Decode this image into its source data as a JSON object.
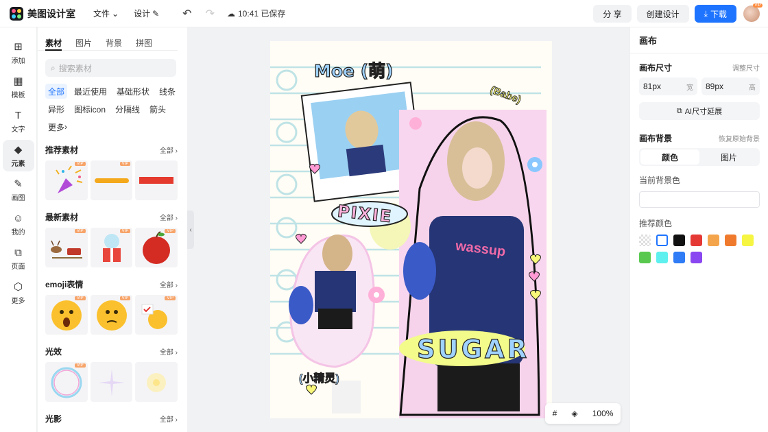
{
  "app": {
    "title": "美图设计室"
  },
  "menu": {
    "file": "文件",
    "design": "设计",
    "saved": "10:41 已保存"
  },
  "actions": {
    "share": "分 享",
    "create": "创建设计",
    "download": "下载",
    "vip": "VIP"
  },
  "rail": [
    {
      "label": "添加",
      "icon": "plus-icon"
    },
    {
      "label": "模板",
      "icon": "template-icon"
    },
    {
      "label": "文字",
      "icon": "text-icon"
    },
    {
      "label": "元素",
      "icon": "elements-icon"
    },
    {
      "label": "画图",
      "icon": "draw-icon"
    },
    {
      "label": "我的",
      "icon": "user-icon"
    },
    {
      "label": "页面",
      "icon": "page-icon"
    },
    {
      "label": "更多",
      "icon": "more-icon"
    }
  ],
  "panel": {
    "tabs": [
      "素材",
      "图片",
      "背景",
      "拼图"
    ],
    "search_placeholder": "搜索素材",
    "chips": [
      "全部",
      "最近使用",
      "基础形状",
      "线条",
      "异形",
      "图标icon",
      "分隔线",
      "箭头",
      "更多"
    ],
    "sections": [
      {
        "title": "推荐素材",
        "all": "全部"
      },
      {
        "title": "最新素材",
        "all": "全部"
      },
      {
        "title": "emoji表情",
        "all": "全部"
      },
      {
        "title": "光效",
        "all": "全部"
      },
      {
        "title": "光影",
        "all": "全部"
      }
    ],
    "vip": "VIP"
  },
  "canvas": {
    "texts": {
      "moe": "Moe (萌)",
      "babe": "(Babe)",
      "pixie": "PIXIE",
      "sugar": "SUGAR",
      "elf": "(小精灵)",
      "wassup": "wassup"
    }
  },
  "zoom": "100%",
  "inspector": {
    "title": "画布",
    "size_label": "画布尺寸",
    "adjust": "调整尺寸",
    "width": "81px",
    "width_unit": "宽",
    "height": "89px",
    "height_unit": "高",
    "ai_button": "AI尺寸延展",
    "bg_label": "画布背景",
    "restore": "恢复原始背景",
    "seg": [
      "颜色",
      "图片"
    ],
    "current_bg": "当前背景色",
    "recommend": "推荐颜色",
    "colors": [
      "#ffffff",
      "#111111",
      "#e53935",
      "#f4a54c",
      "#ef7a2d",
      "#f5f542",
      "#58c94e",
      "#5ef0ee",
      "#2f7cf6",
      "#8a46f0"
    ]
  }
}
